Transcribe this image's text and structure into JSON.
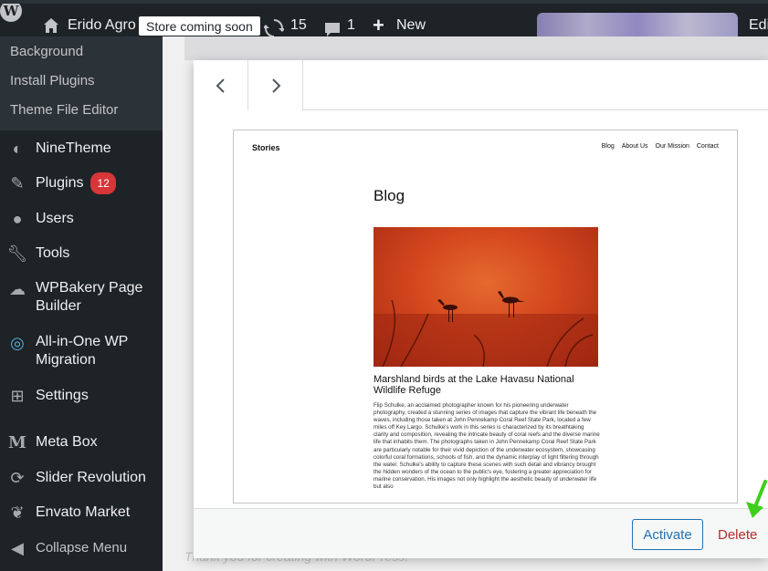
{
  "adminbar": {
    "site_name": "Erido Agro",
    "store_badge": "Store coming soon",
    "updates_count": "15",
    "comments_count": "1",
    "new_label": "New",
    "edit_label": "Edi"
  },
  "sidebar": {
    "submenu": [
      "Background",
      "Install Plugins",
      "Theme File Editor"
    ],
    "items": [
      {
        "label": "NineTheme",
        "icon": "ninetheme-icon"
      },
      {
        "label": "Plugins",
        "icon": "plugins-icon",
        "badge": "12"
      },
      {
        "label": "Users",
        "icon": "users-icon"
      },
      {
        "label": "Tools",
        "icon": "tools-icon"
      },
      {
        "label_line1": "WPBakery Page",
        "label_line2": "Builder",
        "icon": "wpbakery-icon"
      },
      {
        "label_line1": "All-in-One WP",
        "label_line2": "Migration",
        "icon": "migration-icon"
      },
      {
        "label": "Settings",
        "icon": "settings-icon"
      },
      {
        "label": "Meta Box",
        "icon": "metabox-icon"
      },
      {
        "label": "Slider Revolution",
        "icon": "slider-revolution-icon"
      },
      {
        "label": "Envato Market",
        "icon": "envato-icon"
      },
      {
        "label": "Collapse Menu",
        "icon": "collapse-icon"
      }
    ]
  },
  "main": {
    "footer_text": "Thank you for creating with WordPress."
  },
  "modal": {
    "activate_label": "Activate",
    "delete_label": "Delete"
  },
  "preview": {
    "site_title": "Stories",
    "nav": [
      "Blog",
      "About Us",
      "Our Mission",
      "Contact"
    ],
    "page_title": "Blog",
    "post_title": "Marshland birds at the Lake Havasu National Wildlife Refuge",
    "post_body": "Flip Schulke, an acclaimed photographer known for his pioneering underwater photography, created a stunning series of images that capture the vibrant life beneath the waves, including those taken at John Pennekamp Coral Reef State Park, located a few miles off Key Largo. Schulke's work in this series is characterized by its breathtaking clarity and composition, revealing the intricate beauty of coral reefs and the diverse marine life that inhabits them. The photographs taken in John Pennekamp Coral Reef State Park are particularly notable for their vivid depiction of the underwater ecosystem, showcasing colorful coral formations, schools of fish, and the dynamic interplay of light filtering through the water. Schulke's ability to capture these scenes with such detail and vibrancy brought the hidden wonders of the ocean to the public's eye, fostering a greater appreciation for marine conservation. His images not only highlight the aesthetic beauty of underwater life but also"
  },
  "colors": {
    "admin_dark": "#1d2327",
    "accent_blue": "#2271b1",
    "delete_red": "#b32d2e",
    "badge_red": "#d63638",
    "annotation_green": "#3ecf1c"
  }
}
